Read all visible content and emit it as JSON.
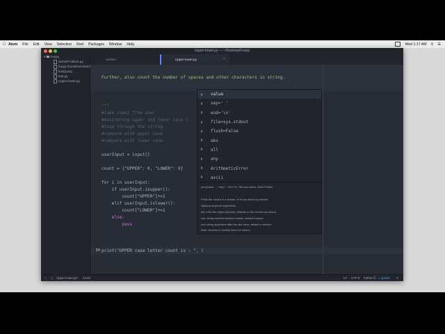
{
  "menubar": {
    "apple": "",
    "items": [
      "Atom",
      "File",
      "Edit",
      "View",
      "Selection",
      "Find",
      "Packages",
      "Window",
      "Help"
    ],
    "clock": "Wed 1:17 AM"
  },
  "window": {
    "title": "Upper-lower.py — ~/Desktop/Funpy"
  },
  "tree": {
    "root": "Funpy",
    "files": [
      "doGetProblem.py",
      "funpy-thumbnail.sketch",
      "funpy.png",
      "test.py",
      "Upper-lower.py"
    ]
  },
  "tabs": [
    {
      "label": "untitled",
      "active": false
    },
    {
      "label": "Upper-lower.py",
      "active": true
    }
  ],
  "editor": {
    "lines": [
      {
        "num": "",
        "text": "Further, also count the number of spaces and other characters in string."
      },
      {
        "num": "",
        "text": "'''"
      },
      {
        "num": "",
        "text": "#take input from user"
      },
      {
        "num": "",
        "text": "#monitoring upper and lower case l"
      },
      {
        "num": "",
        "text": "#loop through the string"
      },
      {
        "num": "",
        "text": "#compare with upper case"
      },
      {
        "num": "",
        "text": "#compare with lower case"
      },
      {
        "num": "",
        "text": "userInput = input()"
      },
      {
        "num": "",
        "text": "count = {\"UPPER\": 0, \"LOWER\": 0}"
      },
      {
        "num": "",
        "text": "for i in userInput:"
      },
      {
        "num": "",
        "text": "    if userInput.isupper():"
      },
      {
        "num": "",
        "text": "        count[\"UPPER\"]+=1"
      },
      {
        "num": "",
        "text": "    elif userInput.islower():"
      },
      {
        "num": "",
        "text": "        count[\"LOWER\"]+=1"
      },
      {
        "num": "",
        "text": "    else:"
      },
      {
        "num": "",
        "text": "        pass"
      },
      {
        "num": "34",
        "text": "print(\"UPPER case letter count is : \", )"
      }
    ]
  },
  "autocomplete": {
    "items": [
      {
        "badge": "p",
        "label": "value"
      },
      {
        "badge": "p",
        "label": "sep=' '"
      },
      {
        "badge": "p",
        "label": "end='\\n'"
      },
      {
        "badge": "p",
        "label": "file=sys.stdout"
      },
      {
        "badge": "p",
        "label": "flush=False"
      },
      {
        "badge": "b",
        "label": "abs"
      },
      {
        "badge": "b",
        "label": "all"
      },
      {
        "badge": "b",
        "label": "any"
      },
      {
        "badge": "b",
        "label": "ArithmeticError"
      },
      {
        "badge": "b",
        "label": "ascii"
      }
    ],
    "doc": {
      "signature": "print(value, ..., sep=' ', end='\\n', file=sys.stdout, flush=False)",
      "line1": "Prints the values to a stream, or to sys.stdout by default.",
      "line2": "Optional keyword arguments:",
      "line3": "file:  a file-like object (stream); defaults to the current sys.stdout.",
      "line4": "sep:   string inserted between values, default a space.",
      "line5": "end:   string appended after the last value, default a newline.",
      "line6": "flush: whether to forcibly flush the stream."
    }
  },
  "status": {
    "file": "Upper-lower.py*",
    "position": "34:40",
    "line_ending": "LF",
    "encoding": "UTF-8",
    "grammar": "Python",
    "update": "1 update"
  }
}
